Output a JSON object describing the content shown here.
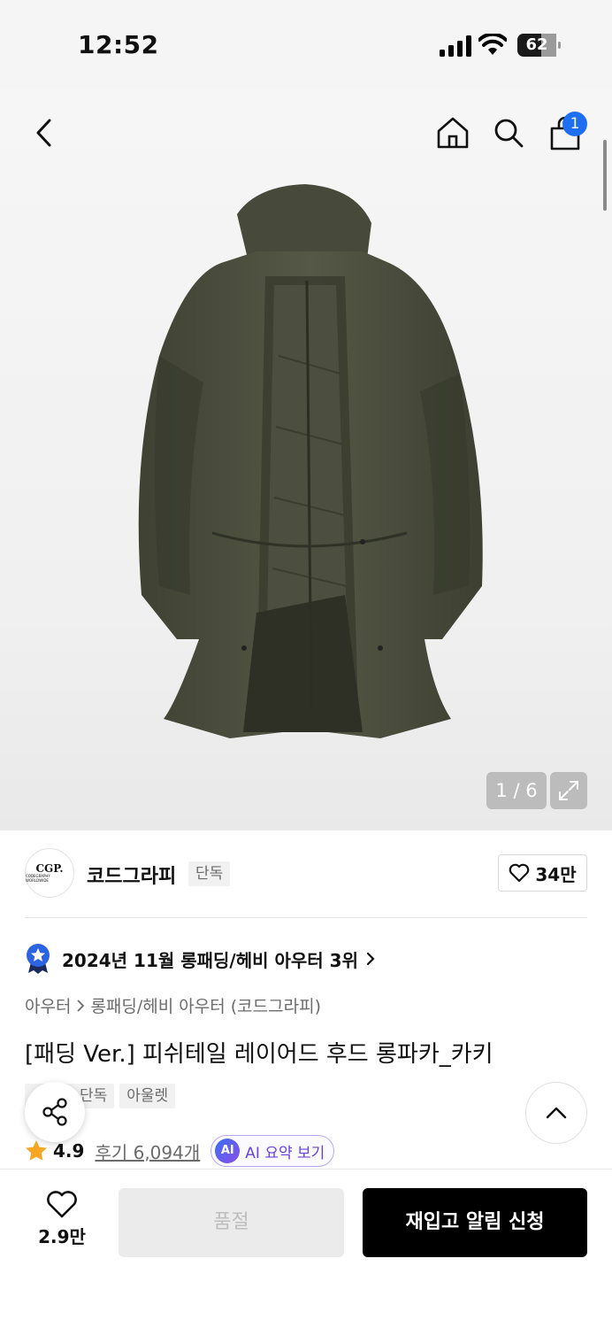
{
  "status_bar": {
    "time": "12:52",
    "battery": "62"
  },
  "gallery": {
    "counter": "1 / 6"
  },
  "header": {
    "cart_count": "1"
  },
  "brand": {
    "logo_text": "CGP.",
    "logo_subtext": "CODEGRAPHY WORLDWIDE",
    "name": "코드그라피",
    "tag": "단독",
    "like_count": "34만"
  },
  "ranking": {
    "text": "2024년 11월 롱패딩/헤비 아우터 3위"
  },
  "breadcrumb": {
    "category": "아우터",
    "subcategory": "롱패딩/헤비 아우터 (코드그라피)"
  },
  "product": {
    "title": "[패딩 Ver.] 피쉬테일 레이어드 후드 롱파카_카키",
    "tags": [
      "단독",
      "아울렛"
    ],
    "rating": "4.9",
    "reviews": "후기 6,094개",
    "ai_badge": "AI",
    "ai_label": "AI 요약 보기"
  },
  "bottom_bar": {
    "wish_count": "2.9만",
    "soldout_label": "품절",
    "restock_label": "재입고 알림 신청"
  },
  "colors": {
    "accent_blue": "#1e6ef2",
    "ai_purple": "#6a42d8",
    "star": "#f5a623",
    "coat_khaki": "#4a4d3a"
  }
}
